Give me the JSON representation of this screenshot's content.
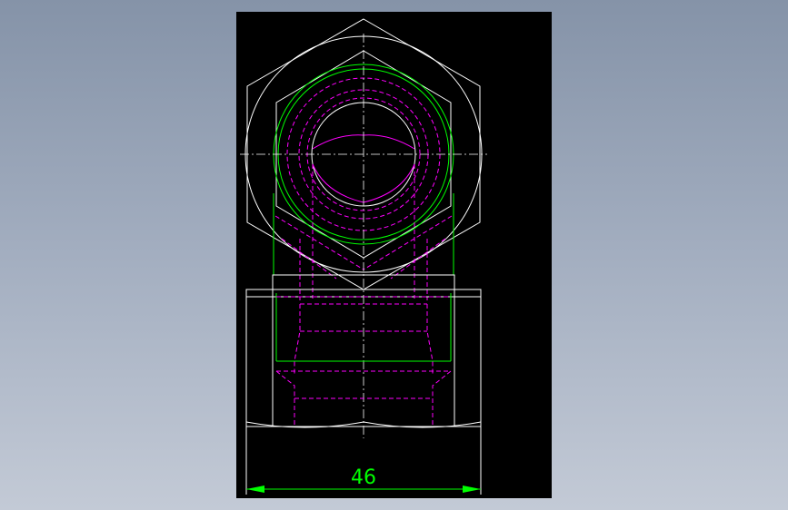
{
  "drawing": {
    "dimension_label": "46"
  },
  "colors": {
    "background": "#000000",
    "outline": "#ffffff",
    "thread": "#00ff00",
    "hidden": "#ff00ff",
    "dimension": "#00ff00"
  }
}
